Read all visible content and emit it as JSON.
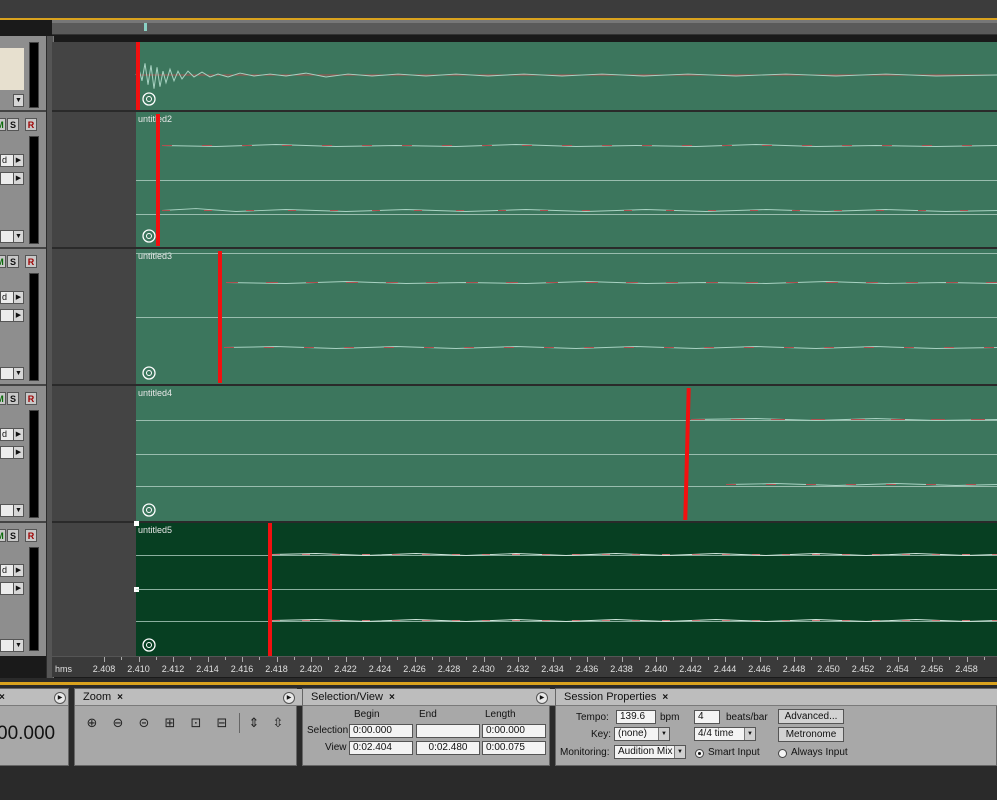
{
  "tracks": [
    {
      "clip_name": ""
    },
    {
      "clip_name": "untitled2",
      "field_label": "d",
      "arrow": "▶"
    },
    {
      "clip_name": "untitled3",
      "field_label": "d",
      "arrow": "▶"
    },
    {
      "clip_name": "untitled4",
      "field_label": "d",
      "arrow": "▶"
    },
    {
      "clip_name": "untitled5",
      "field_label": "d",
      "arrow": "▶"
    }
  ],
  "header_buttons": {
    "mute": "M",
    "solo": "S",
    "record": "R"
  },
  "ruler": {
    "unit": "hms",
    "labels": [
      "2.408",
      "2.410",
      "2.412",
      "2.414",
      "2.416",
      "2.418",
      "2.420",
      "2.422",
      "2.424",
      "2.426",
      "2.428",
      "2.430",
      "2.432",
      "2.434",
      "2.436",
      "2.438",
      "2.440",
      "2.442",
      "2.444",
      "2.446",
      "2.448",
      "2.450",
      "2.452",
      "2.454",
      "2.456",
      "2.458",
      "2."
    ]
  },
  "time_display": {
    "value": "00.000"
  },
  "zoom_panel": {
    "title": "Zoom",
    "close": "×",
    "buttons": [
      "zoom-in-amplitude",
      "zoom-out-amplitude",
      "zoom-out-full",
      "zoom-in",
      "zoom-to-selection",
      "zoom-full",
      "zoom-in-vertical",
      "zoom-out-vertical"
    ]
  },
  "selection_panel": {
    "title": "Selection/View",
    "close": "×",
    "col_begin": "Begin",
    "col_end": "End",
    "col_length": "Length",
    "row_selection": "Selection",
    "row_view": "View",
    "selection_begin": "0:00.000",
    "selection_end": "",
    "selection_length": "0:00.000",
    "view_begin": "0:02.404",
    "view_end": "0:02.480",
    "view_length": "0:00.075"
  },
  "session_panel": {
    "title": "Session Properties",
    "close": "×",
    "tempo_label": "Tempo:",
    "tempo_value": "139.6",
    "tempo_unit": "bpm",
    "beats_value": "4",
    "beats_unit": "beats/bar",
    "advanced_button": "Advanced...",
    "key_label": "Key:",
    "key_value": "(none)",
    "time_sig_value": "4/4 time",
    "metronome_button": "Metronome",
    "monitoring_label": "Monitoring:",
    "monitoring_value": "Audition Mix",
    "smart_input": "Smart Input",
    "always_input": "Always Input",
    "smart_input_selected": true
  },
  "colors": {
    "clip": "#3c765d",
    "clip_selected": "#073f22",
    "playhead": "#f21010",
    "accent": "#d9a21e"
  }
}
